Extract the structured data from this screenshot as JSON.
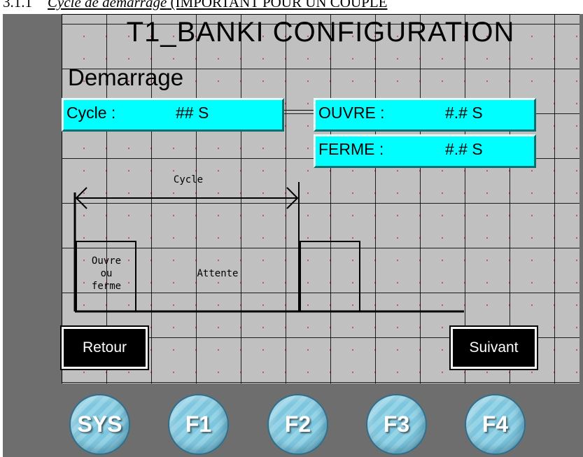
{
  "heading": {
    "number": "3.1.1",
    "italic": "Cycle de démarrage",
    "rest": " (IMPORTANT POUR UN COUPLE"
  },
  "screen": {
    "title": "T1_BANKI CONFIGURATION",
    "subtitle": "Demarrage",
    "fields": {
      "cycle": {
        "label": "Cycle :",
        "value": "## S"
      },
      "ouvre": {
        "label": "OUVRE :",
        "value": "#.# S"
      },
      "ferme": {
        "label": "FERME :",
        "value": "#.# S"
      }
    },
    "diagram": {
      "cycle_label": "Cycle",
      "pulse_label": [
        "Ouvre",
        "ou",
        "ferme"
      ],
      "wait_label": "Attente"
    },
    "buttons": {
      "back": "Retour",
      "next": "Suivant"
    }
  },
  "function_keys": [
    "SYS",
    "F1",
    "F2",
    "F3",
    "F4"
  ],
  "colors": {
    "bezel": "#6e6e6e",
    "screen": "#c0c0c0",
    "field": "#00ffff",
    "button": "#000000",
    "function_key": "#7ec6dd"
  }
}
